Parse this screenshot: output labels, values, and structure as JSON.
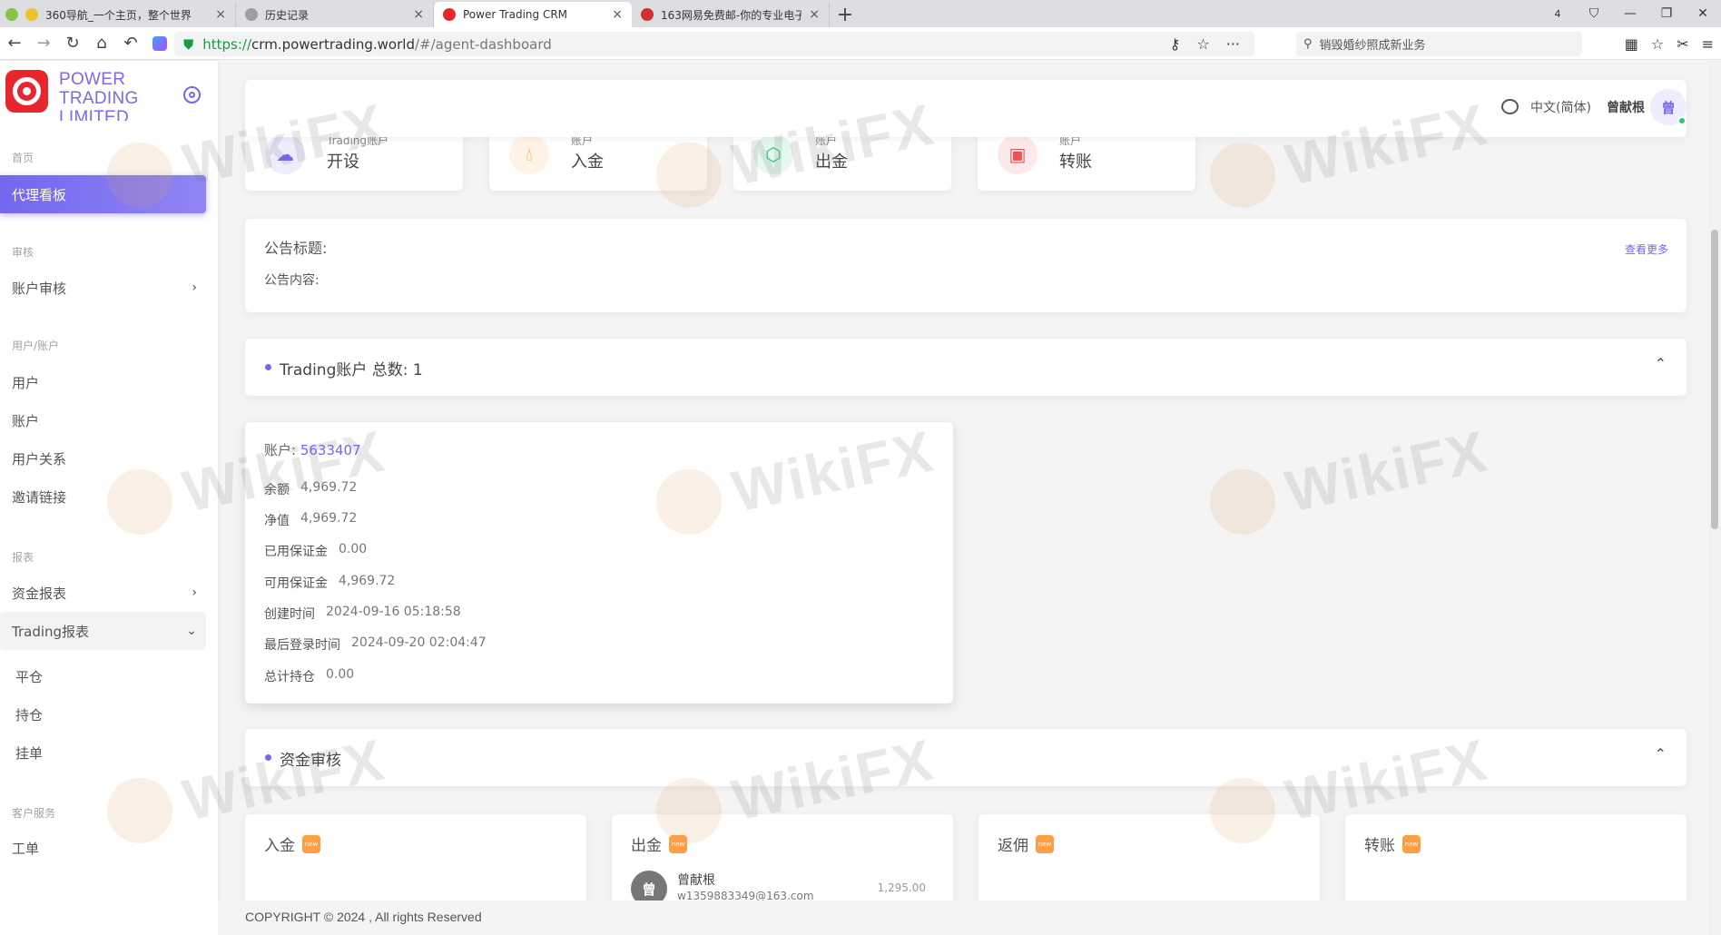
{
  "browser": {
    "tabs": [
      {
        "title": "360导航_一个主页，整个世界",
        "active": false
      },
      {
        "title": "历史记录",
        "active": false
      },
      {
        "title": "Power Trading CRM",
        "active": true
      },
      {
        "title": "163网易免费邮-你的专业电子",
        "active": false
      }
    ],
    "tab_count": "4",
    "url_protocol": "https://",
    "url_host": "crm.powertrading.world",
    "url_path": "/#/agent-dashboard",
    "search_text": "销毁婚纱照成新业务"
  },
  "sidebar": {
    "logo_text": "POWER TRADING LIMITED",
    "sections": {
      "home": "首页",
      "review": "审核",
      "users": "用户/账户",
      "reports": "报表",
      "service": "客户服务"
    },
    "items": {
      "agent_dashboard": "代理看板",
      "account_review": "账户审核",
      "users": "用户",
      "accounts": "账户",
      "user_relations": "用户关系",
      "invite_link": "邀请链接",
      "fund_report": "资金报表",
      "trading_report": "Trading报表",
      "closed": "平仓",
      "positions": "持仓",
      "pending": "挂单",
      "tickets": "工单"
    }
  },
  "topnav": {
    "language": "中文(简体)",
    "username": "曾献根",
    "avatar_initial": "曾"
  },
  "quick_actions": [
    {
      "small": "Trading账户",
      "big": "开设",
      "icon": "cloud-icon",
      "color": "#7367f0"
    },
    {
      "small": "账户",
      "big": "入金",
      "icon": "drop-icon",
      "color": "#ff9f43"
    },
    {
      "small": "账户",
      "big": "出金",
      "icon": "box-icon",
      "color": "#28c76f"
    },
    {
      "small": "账户",
      "big": "转账",
      "icon": "chip-icon",
      "color": "#ea5455"
    }
  ],
  "notice": {
    "title": "公告标题:",
    "content": "公告内容:",
    "more": "查看更多"
  },
  "trading_section": {
    "label": "Trading账户 总数: 1"
  },
  "account": {
    "title_prefix": "账户:",
    "number": "5633407",
    "rows": [
      {
        "label": "余额",
        "value": "4,969.72"
      },
      {
        "label": "净值",
        "value": "4,969.72"
      },
      {
        "label": "已用保证金",
        "value": "0.00"
      },
      {
        "label": "可用保证金",
        "value": "4,969.72"
      },
      {
        "label": "创建时间",
        "value": "2024-09-16 05:18:58"
      },
      {
        "label": "最后登录时间",
        "value": "2024-09-20 02:04:47"
      },
      {
        "label": "总计持仓",
        "value": "0.00"
      }
    ]
  },
  "fund_section": {
    "label": "资金审核"
  },
  "fund_cards": [
    {
      "title": "入金",
      "badge": "new"
    },
    {
      "title": "出金",
      "badge": "new",
      "entry": {
        "avatar": "曾",
        "name": "曾献根",
        "email": "w1359883349@163.com",
        "amount": "1,295.00"
      }
    },
    {
      "title": "返佣",
      "badge": "new"
    },
    {
      "title": "转账",
      "badge": "new"
    }
  ],
  "footer": {
    "copyright": "COPYRIGHT © 2024 , All rights Reserved"
  },
  "watermark": "WikiFX"
}
